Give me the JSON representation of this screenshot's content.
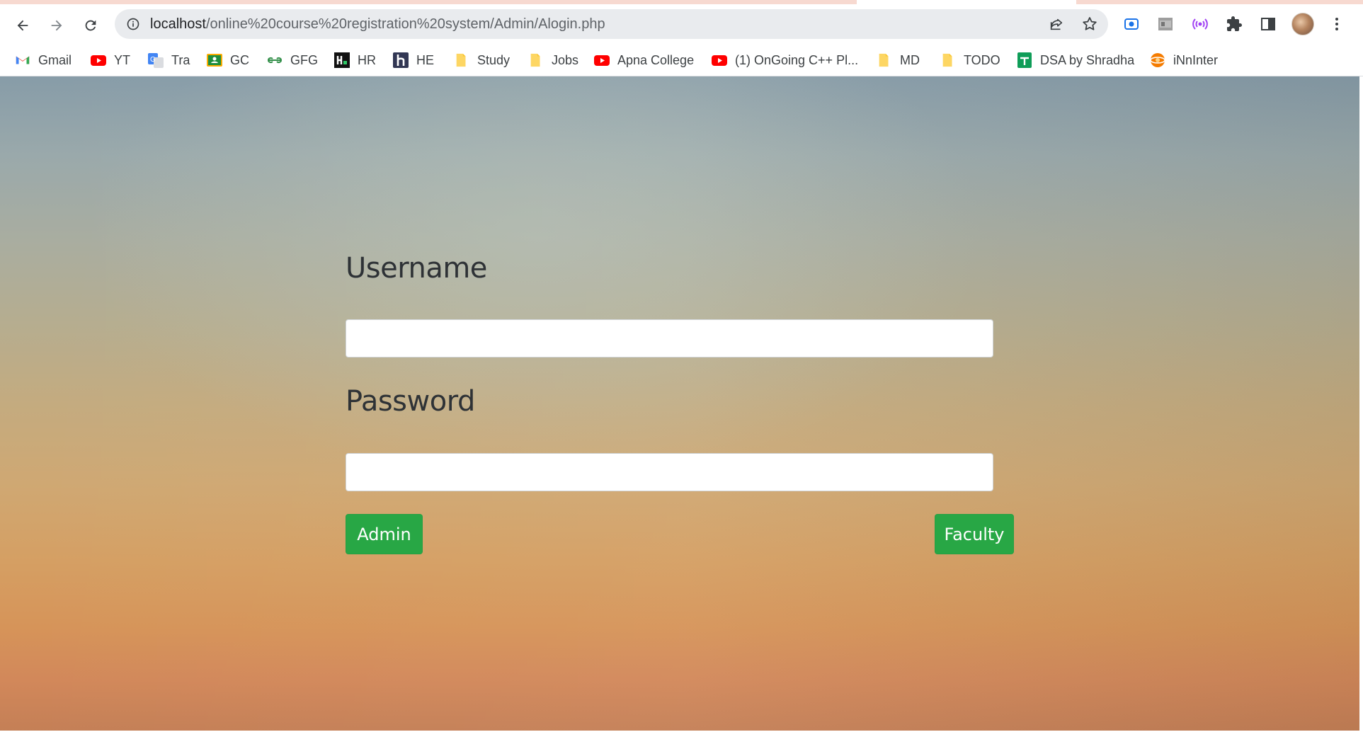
{
  "browser": {
    "url_host": "localhost",
    "url_path": "/online%20course%20registration%20system/Admin/Alogin.php",
    "toolbar_icons": [
      "back-icon",
      "forward-icon",
      "reload-icon",
      "info-icon",
      "share-icon",
      "star-icon",
      "screen-record-icon",
      "tab-thumbnail-icon",
      "broadcast-icon",
      "puzzle-icon",
      "side-panel-icon",
      "kebab-menu-icon"
    ],
    "colors": {
      "omnibox": "#e9ebee",
      "tab_accent": "#f7d9d0"
    }
  },
  "bookmarks": [
    {
      "label": "Gmail",
      "icon": "gmail-icon"
    },
    {
      "label": "YT",
      "icon": "youtube-icon"
    },
    {
      "label": "Tra",
      "icon": "translate-icon"
    },
    {
      "label": "GC",
      "icon": "classroom-icon"
    },
    {
      "label": "GFG",
      "icon": "gfg-icon"
    },
    {
      "label": "HR",
      "icon": "hackerrank-icon"
    },
    {
      "label": "HE",
      "icon": "hackerearth-icon"
    },
    {
      "label": "Study",
      "icon": "folder-icon"
    },
    {
      "label": "Jobs",
      "icon": "folder-icon"
    },
    {
      "label": "Apna College",
      "icon": "youtube-icon"
    },
    {
      "label": "(1) OnGoing C++ Pl...",
      "icon": "youtube-icon"
    },
    {
      "label": "MD",
      "icon": "folder-icon"
    },
    {
      "label": "TODO",
      "icon": "folder-icon"
    },
    {
      "label": "DSA by Shradha",
      "icon": "sheets-icon"
    },
    {
      "label": "iNnInter",
      "icon": "orange-circle-icon"
    }
  ],
  "login": {
    "username_label": "Username",
    "username_value": "",
    "password_label": "Password",
    "password_value": "",
    "admin_button": "Admin",
    "faculty_button": "Faculty",
    "colors": {
      "button": "#28a745",
      "label": "#2e3236"
    }
  }
}
